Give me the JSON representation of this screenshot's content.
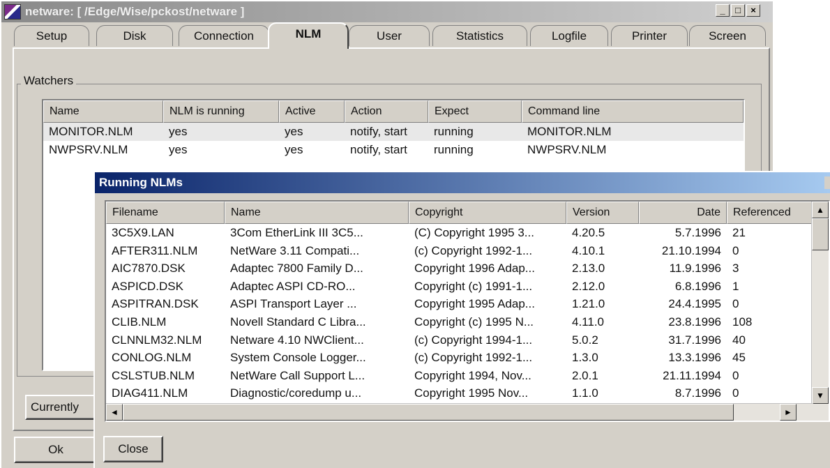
{
  "window": {
    "title": "netware: [ /Edge/Wise/pckost/netware ]",
    "min_glyph": "_",
    "max_glyph": "□",
    "close_glyph": "×"
  },
  "tabs": [
    {
      "label": "Setup",
      "active": false
    },
    {
      "label": "Disk",
      "active": false
    },
    {
      "label": "Connection",
      "active": false
    },
    {
      "label": "NLM",
      "active": true
    },
    {
      "label": "User",
      "active": false
    },
    {
      "label": "Statistics",
      "active": false
    },
    {
      "label": "Logfile",
      "active": false
    },
    {
      "label": "Printer",
      "active": false
    },
    {
      "label": "Screen",
      "active": false
    }
  ],
  "watchers": {
    "group_label": "Watchers",
    "columns": [
      "Name",
      "NLM is running",
      "Active",
      "Action",
      "Expect",
      "Command line"
    ],
    "rows": [
      [
        "MONITOR.NLM",
        "yes",
        "yes",
        "notify, start",
        "running",
        "MONITOR.NLM"
      ],
      [
        "NWPSRV.NLM",
        "yes",
        "yes",
        "notify, start",
        "running",
        "NWPSRV.NLM"
      ]
    ]
  },
  "buttons": {
    "currently": "Currently",
    "ok": "Ok",
    "close": "Close"
  },
  "dialog": {
    "title": "Running NLMs",
    "columns": [
      "Filename",
      "Name",
      "Copyright",
      "Version",
      "Date",
      "Referenced"
    ],
    "rows": [
      [
        "3C5X9.LAN",
        "3Com EtherLink III 3C5...",
        "(C) Copyright 1995 3...",
        "4.20.5",
        "5.7.1996",
        "21"
      ],
      [
        "AFTER311.NLM",
        "NetWare 3.11 Compati...",
        "(c) Copyright 1992-1...",
        "4.10.1",
        "21.10.1994",
        "0"
      ],
      [
        "AIC7870.DSK",
        "Adaptec 7800 Family D...",
        "Copyright 1996 Adap...",
        "2.13.0",
        "11.9.1996",
        "3"
      ],
      [
        "ASPICD.DSK",
        "Adaptec ASPI CD-RO...",
        "Copyright (c) 1991-1...",
        "2.12.0",
        "6.8.1996",
        "1"
      ],
      [
        "ASPITRAN.DSK",
        "ASPI Transport Layer ...",
        "Copyright 1995 Adap...",
        "1.21.0",
        "24.4.1995",
        "0"
      ],
      [
        "CLIB.NLM",
        "Novell Standard C Libra...",
        "Copyright (c) 1995 N...",
        "4.11.0",
        "23.8.1996",
        "108"
      ],
      [
        "CLNNLM32.NLM",
        "Netware 4.10 NWClient...",
        "(c) Copyright 1994-1...",
        "5.0.2",
        "31.7.1996",
        "40"
      ],
      [
        "CONLOG.NLM",
        "System Console Logger...",
        "(c) Copyright 1992-1...",
        "1.3.0",
        "13.3.1996",
        "45"
      ],
      [
        "CSLSTUB.NLM",
        "NetWare Call Support L...",
        "Copyright 1994, Nov...",
        "2.0.1",
        "21.11.1994",
        "0"
      ],
      [
        "DIAG411.NLM",
        "Diagnostic/coredump u...",
        "Copyright 1995 Nov...",
        "1.1.0",
        "8.7.1996",
        "0"
      ]
    ],
    "scroll_up": "▲",
    "scroll_down": "▼",
    "scroll_left": "◄",
    "scroll_right": "►"
  }
}
